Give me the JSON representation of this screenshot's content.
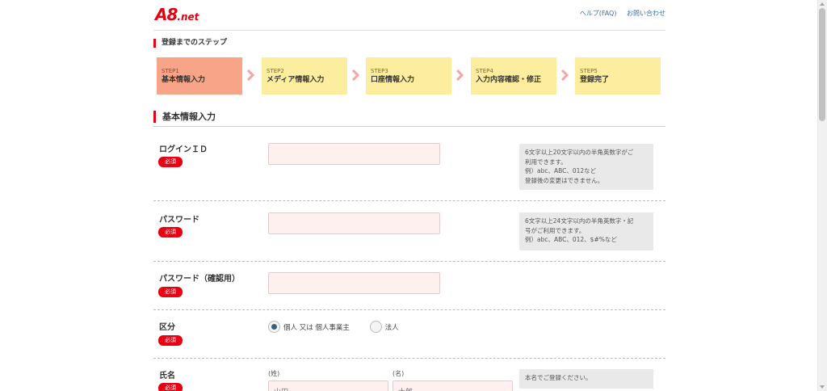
{
  "header": {
    "logo_main": "A8",
    "logo_suffix": ".net",
    "help_link": "ヘルプ(FAQ)",
    "contact_link": "お問い合わせ"
  },
  "steps_heading": "登録までのステップ",
  "steps": [
    {
      "num": "STEP1",
      "name": "基本情報入力",
      "active": true
    },
    {
      "num": "STEP2",
      "name": "メディア情報入力",
      "active": false
    },
    {
      "num": "STEP3",
      "name": "口座情報入力",
      "active": false
    },
    {
      "num": "STEP4",
      "name": "入力内容確認・修正",
      "active": false
    },
    {
      "num": "STEP5",
      "name": "登録完了",
      "active": false
    }
  ],
  "section_title": "基本情報入力",
  "required_label": "必須",
  "form": {
    "login_id": {
      "label": "ログインＩＤ",
      "value": "",
      "hint": [
        "6文字以上20文字以内の半角英数字がご",
        "利用できます。",
        "例）abc、ABC、012など",
        "登録後の変更はできません。"
      ]
    },
    "password": {
      "label": "パスワード",
      "value": "",
      "hint": [
        "6文字以上24文字以内の半角英数字・記",
        "号がご利用できます。",
        "例）abc、ABC、012、$#%など"
      ]
    },
    "password_confirm": {
      "label": "パスワード（確認用）",
      "value": ""
    },
    "category": {
      "label": "区分",
      "options": [
        "個人 又は 個人事業主",
        "法人"
      ],
      "selected": "個人 又は 個人事業主"
    },
    "name": {
      "label": "氏名",
      "last_label": "(姓)",
      "first_label": "(名)",
      "last_placeholder": "山田",
      "first_placeholder": "太郎",
      "hint": [
        "本名でご登録ください。"
      ]
    }
  },
  "colors": {
    "brand": "#e60012",
    "step_active": "#f8a488",
    "step_inactive": "#fcee9e",
    "field_bg": "#fff0f0"
  }
}
